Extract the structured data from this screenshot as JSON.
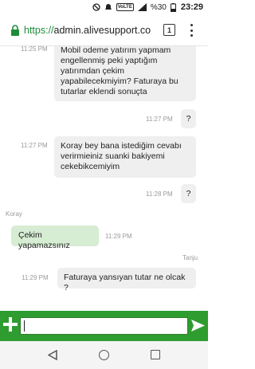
{
  "status_bar": {
    "network_label": "VoLTE",
    "network_type": "4G",
    "battery_percent": "%30",
    "time": "23:29"
  },
  "browser": {
    "url_scheme": "https://",
    "url_rest": "admin.alivesupport.co",
    "tab_count": "1"
  },
  "chat": {
    "messages": [
      {
        "text_lines": [
          "Mobil odeme yatırım yapmam",
          "engellenmiş peki yaptığım",
          "yatırımdan çekim",
          "yapabilecekmiyim? Faturaya bu",
          "tutarlar eklendi sonuçta"
        ],
        "time": "11:25 PM"
      },
      {
        "text": "?",
        "time": "11:27 PM"
      },
      {
        "text_lines": [
          "Koray bey bana istediğim cevabı",
          "verirmieiniz suanki bakiyemi",
          "cekebikcemiyim"
        ],
        "time": "11:27 PM"
      },
      {
        "text": "?",
        "time": "11:28 PM"
      },
      {
        "sender": "Koray",
        "text": "Çekim yapamazsınız",
        "time": "11:29 PM"
      },
      {
        "sender": "Tanju",
        "text": "Faturaya yansıyan tutar ne olcak ?",
        "time": "11:29 PM"
      }
    ]
  },
  "input": {
    "value": "",
    "placeholder": ""
  },
  "colors": {
    "accent_green": "#2e9c2e",
    "support_bubble": "#d6ecd3",
    "visitor_bubble": "#efefef",
    "https_green": "#1e8c3a"
  },
  "icons": [
    "mute-icon",
    "alarm-icon",
    "signal-icon",
    "battery-icon",
    "lock-icon",
    "tabs-icon",
    "more-vert-icon",
    "plus-icon",
    "send-icon",
    "nav-back-icon",
    "nav-home-icon",
    "nav-recent-icon"
  ]
}
